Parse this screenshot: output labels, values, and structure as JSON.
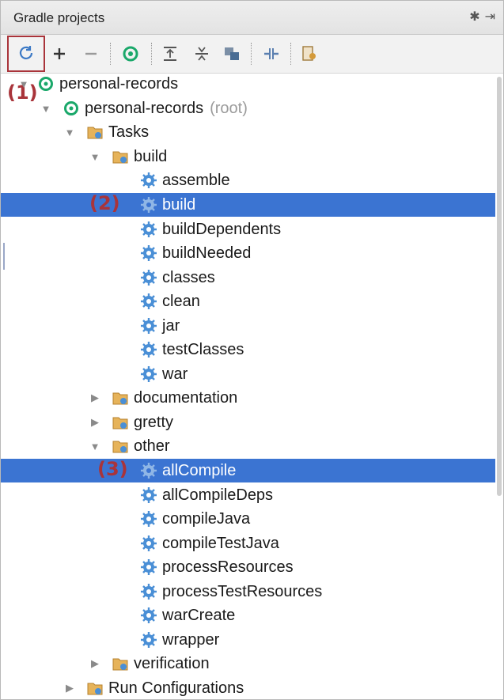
{
  "panel": {
    "title": "Gradle projects"
  },
  "title_icons": [
    {
      "name": "settings-gear-icon",
      "glyph": "✱"
    },
    {
      "name": "hide-panel-icon",
      "glyph": "⇥"
    }
  ],
  "toolbar": {
    "buttons": [
      {
        "name": "refresh-all-projects-button",
        "icon": "refresh-icon"
      },
      {
        "name": "link-project-button",
        "icon": "plus-icon"
      },
      {
        "name": "detach-project-button",
        "icon": "minus-icon"
      },
      {
        "name": "execute-task-button",
        "icon": "gradle-run-icon"
      },
      {
        "name": "expand-all-button",
        "icon": "expand-all-icon"
      },
      {
        "name": "collapse-all-button",
        "icon": "collapse-all-icon"
      },
      {
        "name": "group-tasks-button",
        "icon": "group-icon"
      },
      {
        "name": "toggle-offline-button",
        "icon": "offline-icon"
      },
      {
        "name": "gradle-settings-button",
        "icon": "gradle-settings-icon"
      }
    ]
  },
  "callouts": {
    "one": "(1)",
    "two": "(2)",
    "three": "(3)"
  },
  "tree": {
    "project": "personal-records",
    "module": "personal-records",
    "module_suffix": "(root)",
    "tasks": "Tasks",
    "build_group": "build",
    "build_tasks": [
      "assemble",
      "build",
      "buildDependents",
      "buildNeeded",
      "classes",
      "clean",
      "jar",
      "testClasses",
      "war"
    ],
    "documentation": "documentation",
    "gretty": "gretty",
    "other": "other",
    "other_tasks": [
      "allCompile",
      "allCompileDeps",
      "compileJava",
      "compileTestJava",
      "processResources",
      "processTestResources",
      "warCreate",
      "wrapper"
    ],
    "verification": "verification",
    "run_configurations": "Run Configurations",
    "selected": [
      "build",
      "allCompile"
    ]
  },
  "colors": {
    "selection": "#3b74d2",
    "callout": "#a9343a",
    "gradle_green": "#1aa86a",
    "folder": "#d79a3c",
    "gear": "#4a8fd6"
  }
}
